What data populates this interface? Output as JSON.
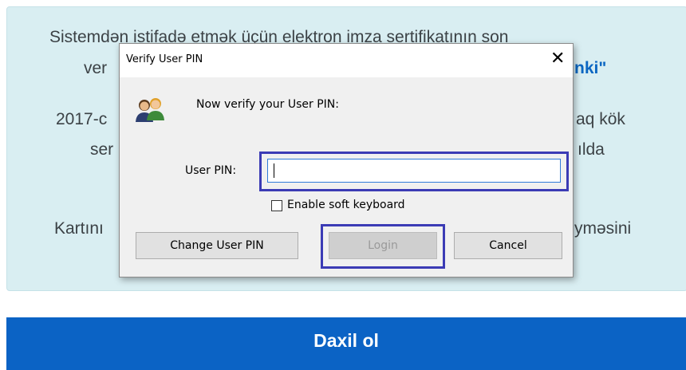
{
  "background": {
    "lines": [
      "Sistemdən istifadə etmək üçün elektron imza sertifikatının son",
      "ver",
      "nki\"",
      "2017-c",
      "aq kök",
      "ser",
      "ılda",
      "Kartını",
      "yməsini"
    ],
    "login_button": "Daxil ol"
  },
  "dialog": {
    "title": "Verify User PIN",
    "close_glyph": "✕",
    "prompt": "Now verify your User PIN:",
    "pin_label": "User PIN:",
    "pin_value": "",
    "soft_keyboard_label": "Enable soft keyboard",
    "soft_keyboard_checked": false,
    "buttons": {
      "change_pin": "Change User PIN",
      "login": "Login",
      "cancel": "Cancel"
    },
    "icon": "users-icon"
  },
  "colors": {
    "panel_bg": "#d9eef2",
    "primary_button": "#0b63c5",
    "highlight": "#3b3bb5",
    "input_border": "#2f7ad8"
  }
}
